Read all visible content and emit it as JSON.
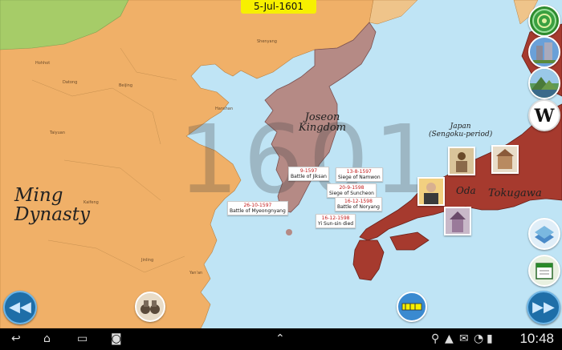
{
  "date": "5-Jul-1601",
  "year_watermark": "1601",
  "regions": {
    "ming_line1": "Ming",
    "ming_line2": "Dynasty",
    "joseon_line1": "Joseon",
    "joseon_line2": "Kingdom",
    "japan_line1": "Japan",
    "japan_line2": "(Sengoku-period)",
    "oda": "Oda",
    "tokugawa": "Tokugawa"
  },
  "cities": [
    "Hohhot",
    "Datong",
    "Beijing",
    "Taiyuan",
    "Kaifeng",
    "Jinling",
    "Shenyang",
    "Hanshan",
    "Yan'an"
  ],
  "events": [
    {
      "date": "9-1597",
      "title": "Battle of Jiksan"
    },
    {
      "date": "13-8-1597",
      "title": "Siege of Namwon"
    },
    {
      "date": "26-10-1597",
      "title": "Battle of Myeongnyang"
    },
    {
      "date": "20-9-1598",
      "title": "Siege of Suncheon"
    },
    {
      "date": "16-12-1598",
      "title": "Battle of Noryang"
    },
    {
      "date": "16-12-1598",
      "title": "Yi Sun-sin died"
    }
  ],
  "colors": {
    "sea": "#bfe4f5",
    "ming": "#f0b068",
    "mongol": "#a6cc68",
    "joseon": "#b58a85",
    "japan": "#a63a2e",
    "date_pill": "#f7f000"
  },
  "right_buttons": [
    "globe-icon",
    "buildings-icon",
    "landscape-icon",
    "wikipedia-icon",
    "map-layer-icon",
    "calendar-icon"
  ],
  "clock": "10:48"
}
